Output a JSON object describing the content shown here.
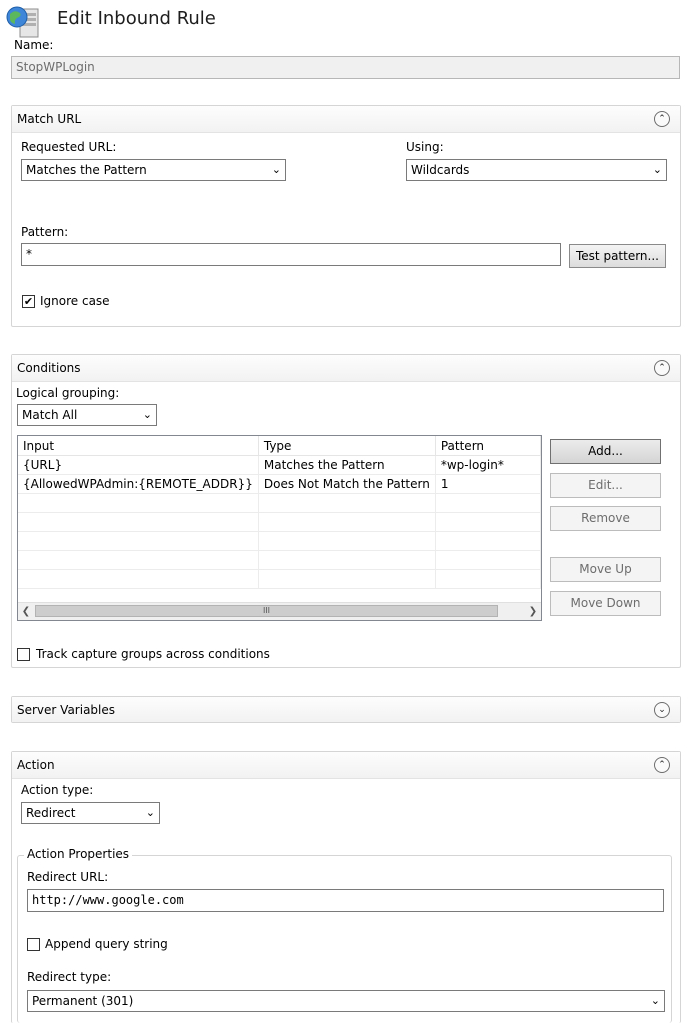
{
  "header": {
    "title": "Edit Inbound Rule"
  },
  "name_field": {
    "label": "Name:",
    "value": "StopWPLogin"
  },
  "match_url": {
    "title": "Match URL",
    "requested_url_label": "Requested URL:",
    "requested_url_value": "Matches the Pattern",
    "using_label": "Using:",
    "using_value": "Wildcards",
    "pattern_label": "Pattern:",
    "pattern_value": "*",
    "test_pattern_label": "Test pattern...",
    "ignore_case_label": "Ignore case",
    "ignore_case_checked": true
  },
  "conditions": {
    "title": "Conditions",
    "logical_grouping_label": "Logical grouping:",
    "logical_grouping_value": "Match All",
    "columns": [
      "Input",
      "Type",
      "Pattern"
    ],
    "rows": [
      [
        "{URL}",
        "Matches the Pattern",
        "*wp-login*"
      ],
      [
        "{AllowedWPAdmin:{REMOTE_ADDR}}",
        "Does Not Match the Pattern",
        "1"
      ]
    ],
    "buttons": {
      "add": "Add...",
      "edit": "Edit...",
      "remove": "Remove",
      "move_up": "Move Up",
      "move_down": "Move Down"
    },
    "track_label": "Track capture groups across conditions",
    "scroll_grip": "III"
  },
  "server_variables": {
    "title": "Server Variables"
  },
  "action": {
    "title": "Action",
    "action_type_label": "Action type:",
    "action_type_value": "Redirect",
    "properties_title": "Action Properties",
    "redirect_url_label": "Redirect URL:",
    "redirect_url_value": "http://www.google.com",
    "append_query_label": "Append query string",
    "redirect_type_label": "Redirect type:",
    "redirect_type_value": "Permanent (301)"
  },
  "icons": {
    "collapse": "chevron-up",
    "expand": "chevron-down",
    "dropdown": "chevron-down",
    "check": "✔"
  }
}
